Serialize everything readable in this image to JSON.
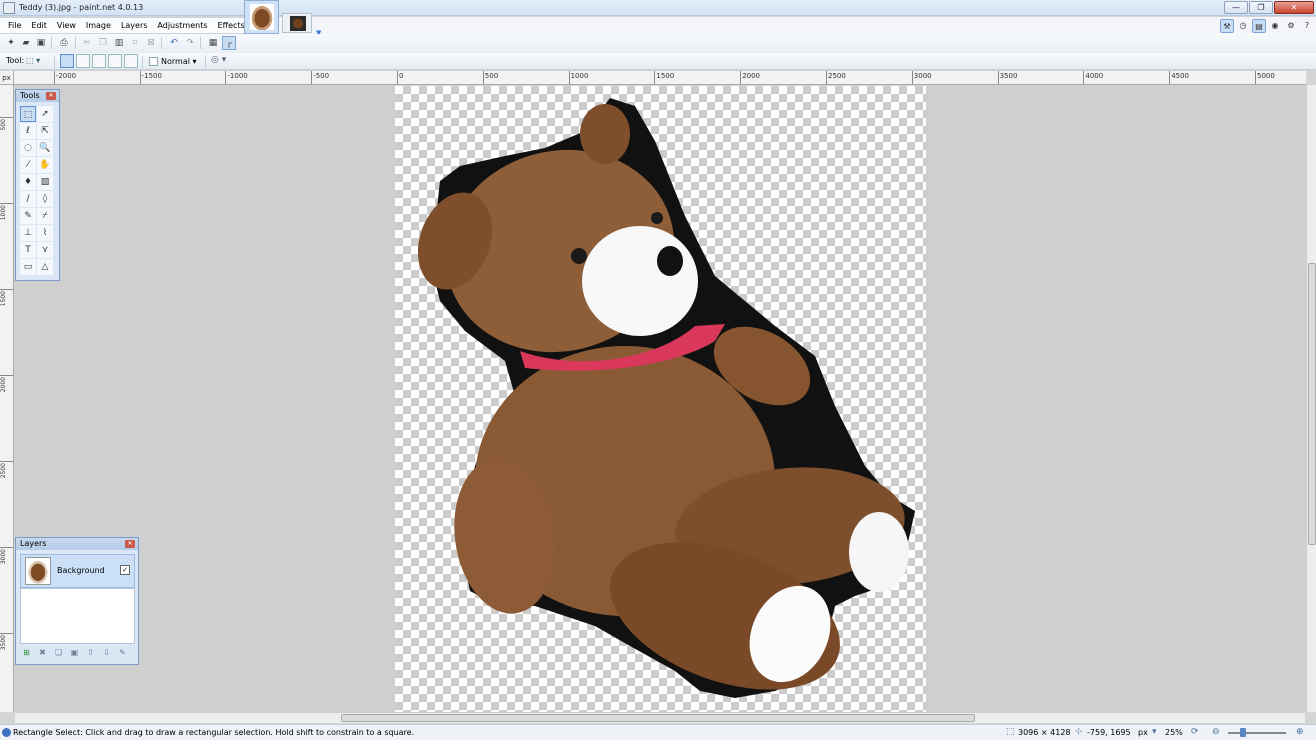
{
  "window": {
    "title": "Teddy (3).jpg - paint.net 4.0.13",
    "minimize": "—",
    "maximize": "❐",
    "close": "✕"
  },
  "menu": [
    "File",
    "Edit",
    "View",
    "Image",
    "Layers",
    "Adjustments",
    "Effects"
  ],
  "toolbar": {
    "tool_label": "Tool:",
    "blend_mode": "Normal"
  },
  "ruler": {
    "unit_corner": "px",
    "h_labels": [
      "-2000",
      "-1500",
      "-1000",
      "-500",
      "0",
      "500",
      "1000",
      "1500",
      "2000",
      "2500",
      "3000",
      "3500",
      "4000",
      "4500",
      "5000"
    ],
    "v_labels": [
      "500",
      "1000",
      "1500",
      "2000",
      "2500",
      "3000",
      "3500"
    ]
  },
  "tools_window": {
    "title": "Tools"
  },
  "layers_window": {
    "title": "Layers",
    "layers": [
      {
        "name": "Background",
        "visible": "✓"
      }
    ]
  },
  "status": {
    "hint": "Rectangle Select: Click and drag to draw a rectangular selection. Hold shift to constrain to a square.",
    "image_size": "3096 × 4128",
    "cursor_pos": "-759, 1695",
    "unit": "px",
    "zoom": "25%"
  },
  "colors": {
    "accent": "#3d73c2",
    "checker": "#cccccc",
    "workspace": "#cfcfcf"
  }
}
